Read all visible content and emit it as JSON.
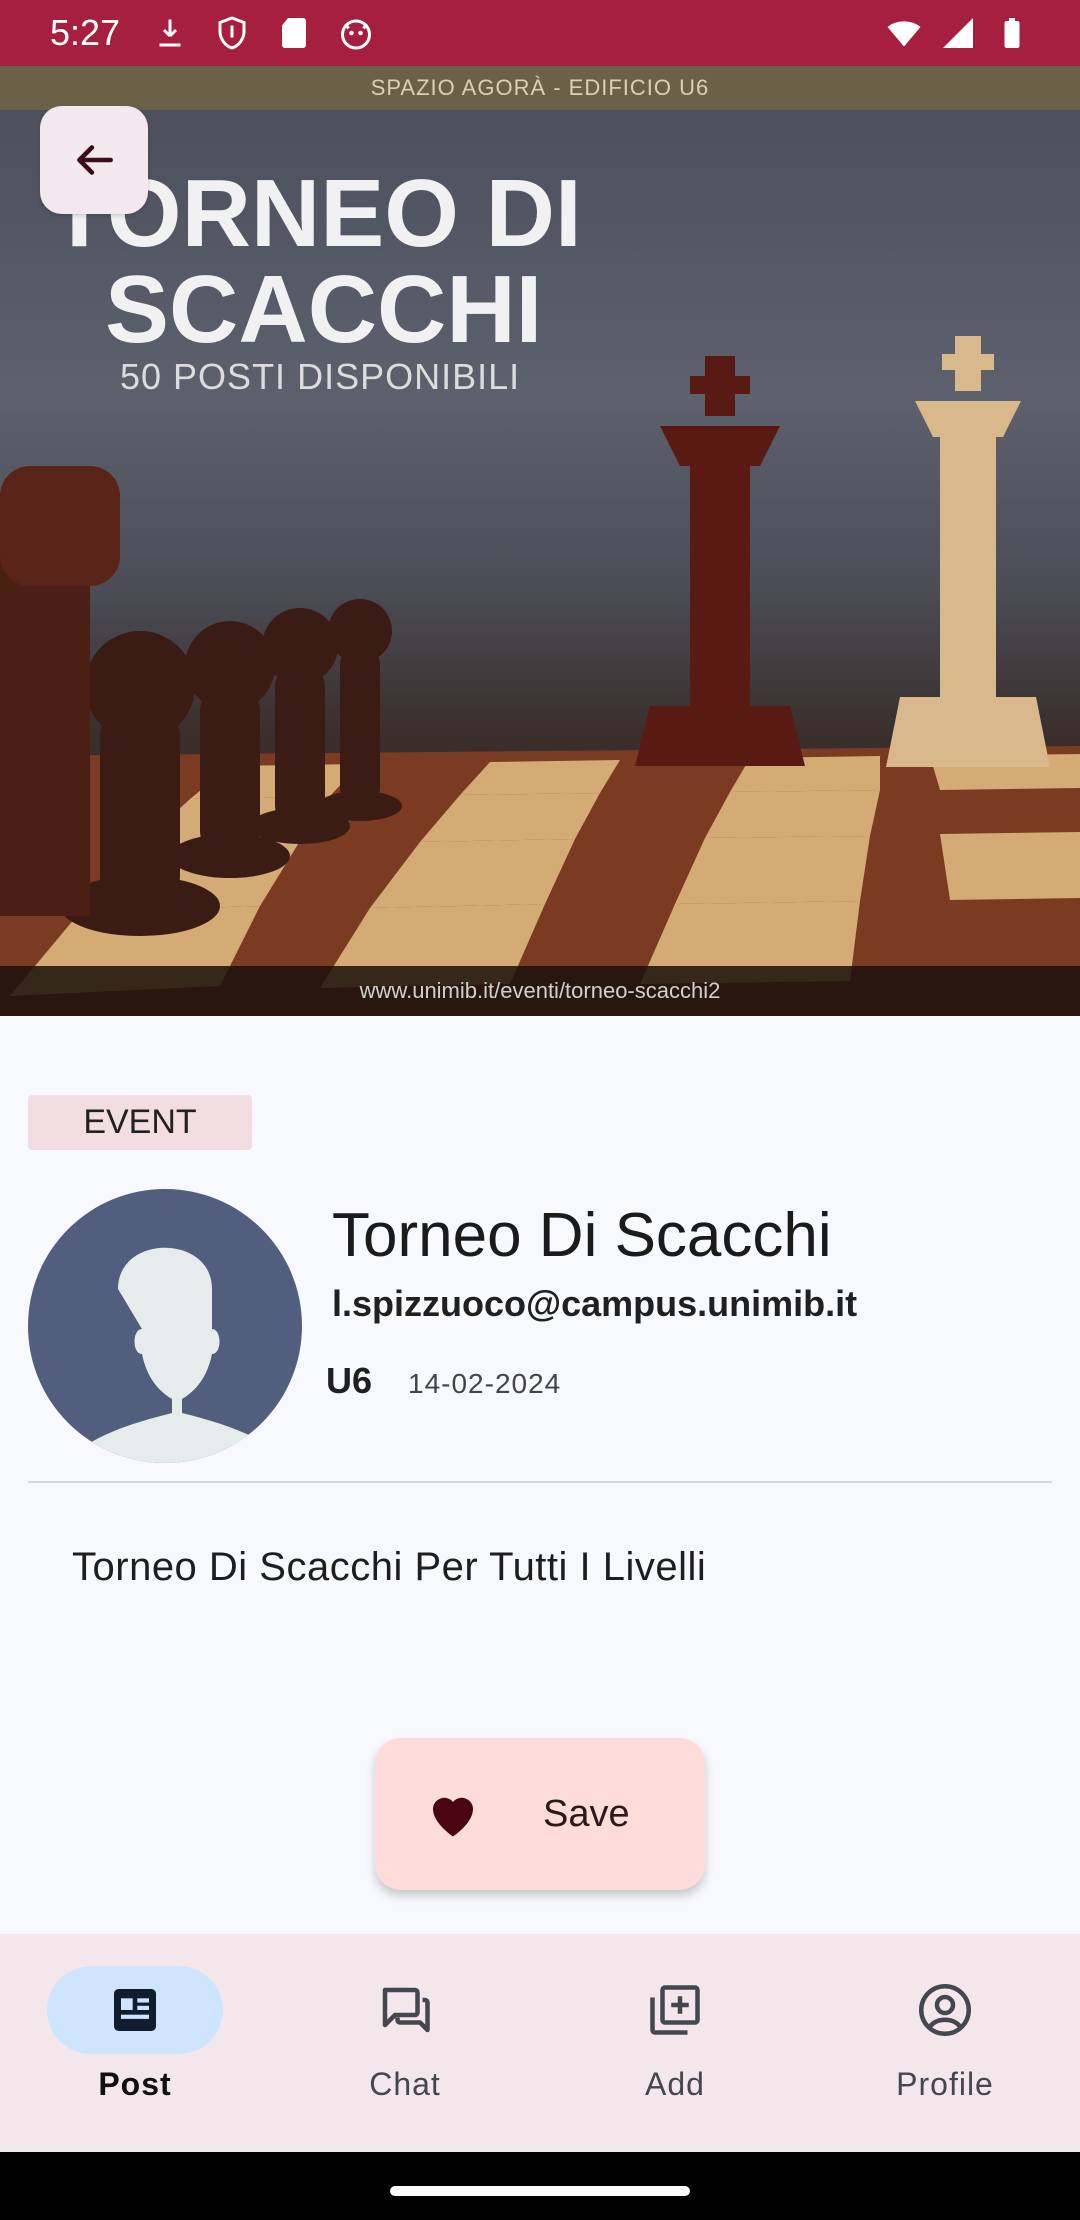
{
  "status_bar": {
    "time": "5:27",
    "left_icons": [
      "download-icon",
      "shield-icon",
      "sd-card-icon",
      "cat-icon"
    ],
    "right_icons": [
      "wifi-icon",
      "signal-icon",
      "battery-icon"
    ],
    "color": "#a71f3f"
  },
  "hero": {
    "top_band": "SPAZIO AGORÀ - EDIFICIO U6",
    "title_line1": "TORNEO DI",
    "title_line2": "SCACCHI",
    "subtitle": "50 POSTI DISPONIBILI",
    "url": "www.unimib.it/eventi/torneo-scacchi2"
  },
  "post": {
    "category": "EVENT",
    "title": "Torneo Di Scacchi",
    "author_email": "l.spizzuoco@campus.unimib.it",
    "building": "U6",
    "date": "14-02-2024",
    "description": "Torneo Di Scacchi Per Tutti I Livelli"
  },
  "save_button": {
    "label": "Save",
    "icon": "heart-icon"
  },
  "bottom_nav": {
    "items": [
      {
        "label": "Post",
        "icon": "article-icon",
        "active": true
      },
      {
        "label": "Chat",
        "icon": "chat-icon",
        "active": false
      },
      {
        "label": "Add",
        "icon": "add-to-photos-icon",
        "active": false
      },
      {
        "label": "Profile",
        "icon": "account-circle-icon",
        "active": false
      }
    ]
  },
  "colors": {
    "accent_active": "#cfe5ff",
    "nav_background": "#f3e7ec",
    "save_background": "#fddcd9",
    "chip_background": "#f2dde3",
    "avatar_background": "#525e7d"
  }
}
